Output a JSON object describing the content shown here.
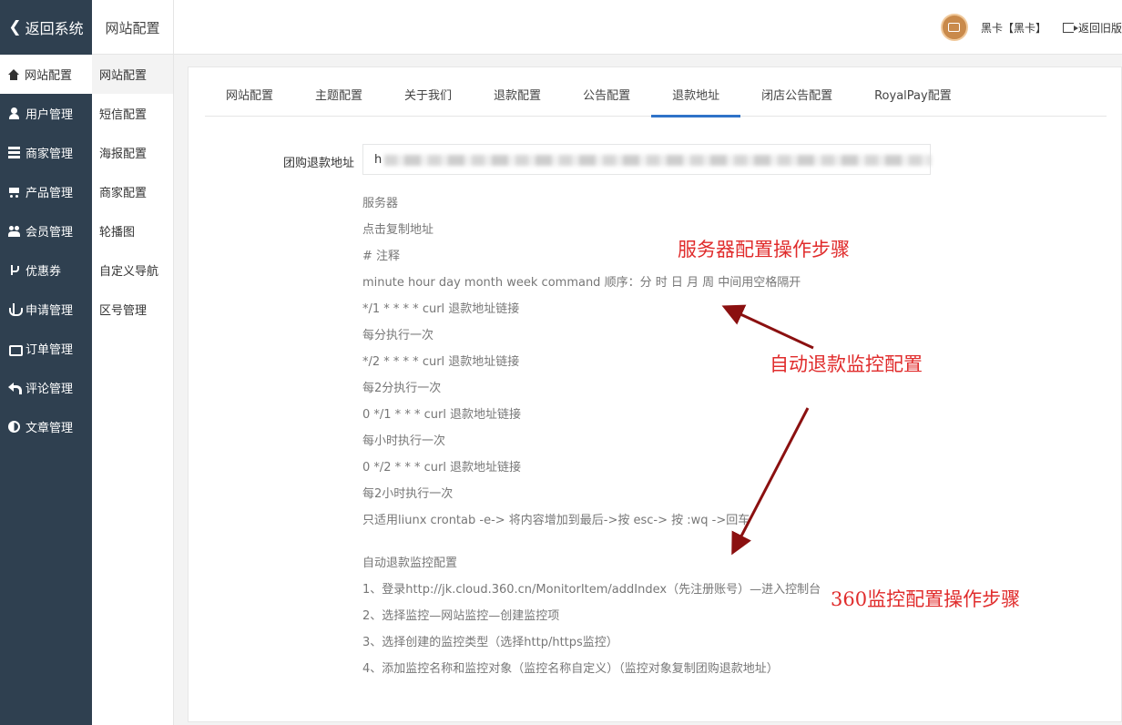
{
  "topbar": {
    "back_label": "返回系统",
    "section_title": "网站配置",
    "user_name": "黑卡【黑卡】",
    "exit_label": "返回旧版"
  },
  "leftnav": {
    "items": [
      {
        "label": "网站配置",
        "icon": "home-icon",
        "active": true
      },
      {
        "label": "用户管理",
        "icon": "user-icon"
      },
      {
        "label": "商家管理",
        "icon": "server-icon"
      },
      {
        "label": "产品管理",
        "icon": "cart-icon"
      },
      {
        "label": "会员管理",
        "icon": "group-icon"
      },
      {
        "label": "优惠券",
        "icon": "branch-icon"
      },
      {
        "label": "申请管理",
        "icon": "anchor-icon"
      },
      {
        "label": "订单管理",
        "icon": "hand-icon"
      },
      {
        "label": "评论管理",
        "icon": "reply-icon"
      },
      {
        "label": "文章管理",
        "icon": "half-circle-icon"
      }
    ]
  },
  "subnav": {
    "items": [
      "网站配置",
      "短信配置",
      "海报配置",
      "商家配置",
      "轮播图",
      "自定义导航",
      "区号管理"
    ]
  },
  "tabs": [
    "网站配置",
    "主题配置",
    "关于我们",
    "退款配置",
    "公告配置",
    "退款地址",
    "闭店公告配置",
    "RoyalPay配置"
  ],
  "form": {
    "label": "团购退款地址",
    "value": "h"
  },
  "help_lines": [
    "服务器",
    "点击复制地址",
    "# 注释",
    "minute hour day month week command 顺序：分 时 日 月 周 中间用空格隔开",
    "*/1 * * * * curl 退款地址链接",
    "每分执行一次",
    "*/2 * * * * curl 退款地址链接",
    "每2分执行一次",
    "0 */1 * * * curl 退款地址链接",
    "每小时执行一次",
    "0 */2 * * * curl 退款地址链接",
    "每2小时执行一次",
    "只适用liunx crontab -e-> 将内容增加到最后->按 esc-> 按 :wq ->回车"
  ],
  "help_lines_2": [
    "自动退款监控配置",
    "1、登录http://jk.cloud.360.cn/MonitorItem/addIndex（先注册账号）—进入控制台",
    "2、选择监控—网站监控—创建监控项",
    "3、选择创建的监控类型（选择http/https监控）",
    "4、添加监控名称和监控对象（监控名称自定义）（监控对象复制团购退款地址）"
  ],
  "annotations": {
    "server_steps": "服务器配置操作步骤",
    "auto_refund": "自动退款监控配置",
    "monitor_360": "360监控配置操作步骤",
    "color": "#e02c2c",
    "arrow_color": "#8b1010"
  },
  "colors": {
    "sidebar": "#2f4050",
    "tab_active": "#2f73c8"
  }
}
